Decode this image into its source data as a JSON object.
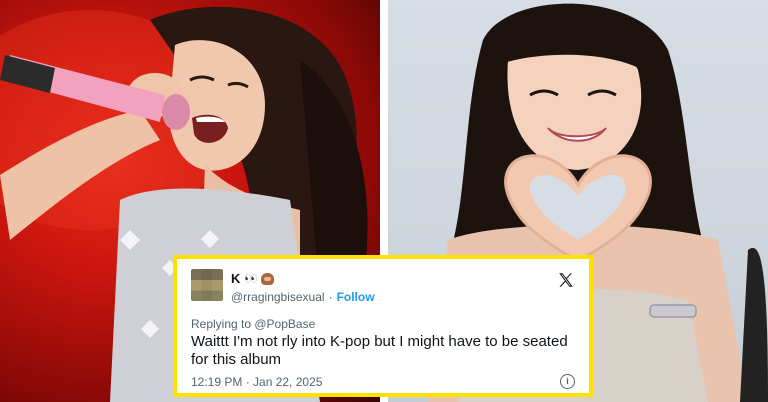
{
  "tweet": {
    "display_name": "K",
    "emoji_eyes": "👀",
    "handle": "@rragingbisexual",
    "separator": "·",
    "follow_label": "Follow",
    "reply_to": "Replying to @PopBase",
    "text": "Waittt I'm not rly into K-pop but I might have to be seated for this album",
    "timestamp": "12:19 PM · Jan 22, 2025",
    "info_glyph": "i"
  },
  "colors": {
    "highlight_border": "#ffe100",
    "follow_link": "#1d9bf0",
    "stage_red": "#c8140e"
  },
  "icons": {
    "platform_logo": "x-logo-icon",
    "info": "info-icon",
    "avatar": "blurred-avatar"
  }
}
